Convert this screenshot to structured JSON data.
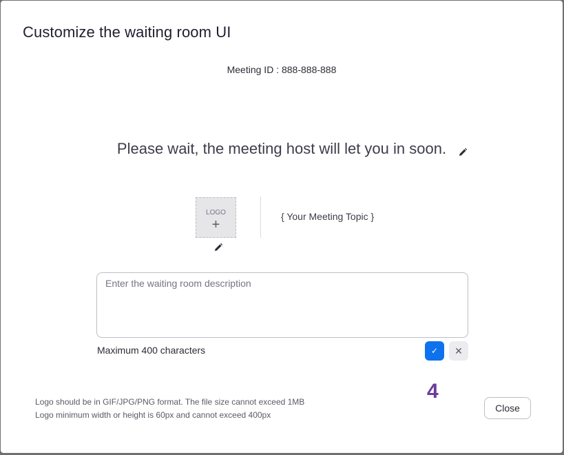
{
  "dialog": {
    "title": "Customize the waiting room UI",
    "meeting_id": "Meeting ID : 888-888-888",
    "headline": "Please wait, the meeting host will let you in soon.",
    "logo_placeholder": "LOGO",
    "logo_plus": "+",
    "meeting_topic": "{ Your Meeting Topic }",
    "description": {
      "value": "",
      "placeholder": "Enter the waiting room description"
    },
    "max_chars_label": "Maximum 400 characters",
    "confirm_glyph": "✓",
    "cancel_glyph": "✕",
    "hint_line1": "Logo should be in GIF/JPG/PNG format. The file size cannot exceed 1MB",
    "hint_line2": "Logo minimum width or height is 60px and cannot exceed 400px",
    "step_marker": "4",
    "close_label": "Close"
  },
  "colors": {
    "accent": "#0e72ed",
    "step_marker": "#6a3d9a",
    "text_primary": "#1f1f2e"
  },
  "icons": {
    "edit": "pencil-icon",
    "confirm": "checkmark-icon",
    "cancel": "close-icon",
    "add": "plus-icon"
  }
}
